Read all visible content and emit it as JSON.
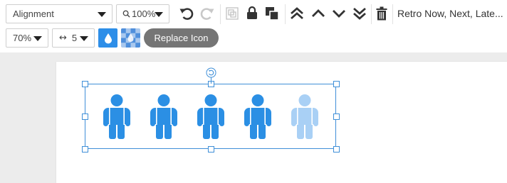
{
  "toolbar": {
    "alignment_label": "Alignment",
    "zoom_label": "100%",
    "retro_label": "Retro Now, Next, Late...",
    "opacity_label": "70%",
    "spacing_icon": "↔",
    "spacing_value": "5",
    "replace_icon_label": "Replace Icon"
  },
  "icons": {
    "toolbar_row1": [
      "search-icon",
      "undo-icon",
      "redo-icon",
      "group-icon",
      "lock-icon",
      "duplicate-icon",
      "bring-to-front-icon",
      "bring-forward-icon",
      "send-backward-icon",
      "send-to-back-icon",
      "trash-icon"
    ],
    "toolbar_row2": [
      "fill-color-icon",
      "transparency-pattern-icon"
    ],
    "canvas": [
      "rotate-icon",
      "person-icon"
    ]
  },
  "pictograph": {
    "icon": "person-icon",
    "total": 5,
    "filled": 4
  },
  "colors": {
    "accent": "#2d8ee8",
    "person_filled": "#2b8fe4",
    "person_faded": "#a9d0f5",
    "selection": "#3f8fd8",
    "button_gray": "#757575",
    "workspace": "#ececec"
  }
}
